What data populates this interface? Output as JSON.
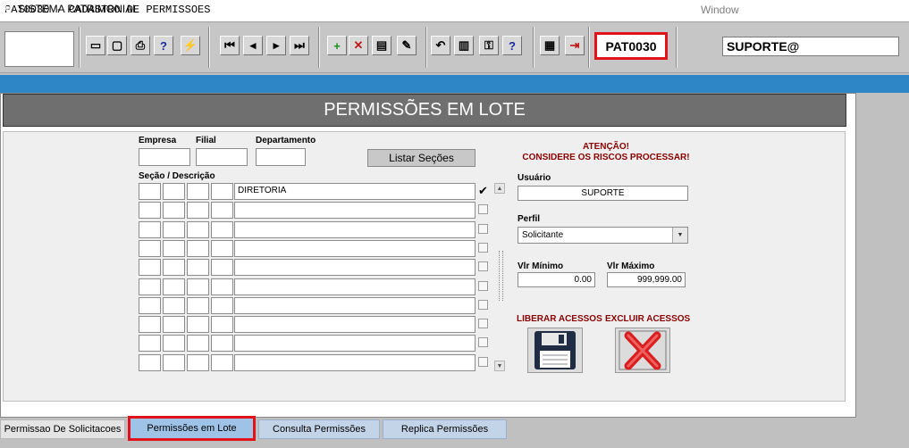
{
  "titlebar": {
    "title": "PAT0030 - CADASTRO DE PERMISSOES",
    "window_menu": "Window"
  },
  "toolbar": {
    "module_code": "PAT0030",
    "user": "SUPORTE@",
    "buttons": [
      {
        "name": "save-icon",
        "glyph": "▭"
      },
      {
        "name": "window-icon",
        "glyph": "▢"
      },
      {
        "name": "print-icon",
        "glyph": "⎙"
      },
      {
        "name": "help-query-icon",
        "glyph": "?"
      },
      {
        "name": "execute-query-icon",
        "glyph": "⚡"
      },
      {
        "name": "first-record-icon",
        "glyph": "⏮"
      },
      {
        "name": "previous-record-icon",
        "glyph": "◂"
      },
      {
        "name": "next-record-icon",
        "glyph": "▸"
      },
      {
        "name": "last-record-icon",
        "glyph": "⏭"
      },
      {
        "name": "insert-record-icon",
        "glyph": "+"
      },
      {
        "name": "delete-record-icon",
        "glyph": "✕"
      },
      {
        "name": "duplicate-record-icon",
        "glyph": "▤"
      },
      {
        "name": "clear-record-icon",
        "glyph": "✎"
      },
      {
        "name": "undo-icon",
        "glyph": "↶"
      },
      {
        "name": "clipboard-icon",
        "glyph": "▥"
      },
      {
        "name": "keys-icon",
        "glyph": "⚿"
      },
      {
        "name": "help-icon",
        "glyph": "?"
      },
      {
        "name": "menu-icon",
        "glyph": "▦"
      },
      {
        "name": "exit-icon",
        "glyph": "⇥"
      }
    ]
  },
  "system_bar": {
    "label": "SISTEMA PATRIMONIAL"
  },
  "header": {
    "title": "PERMISSÕES EM LOTE"
  },
  "form": {
    "empresa_label": "Empresa",
    "filial_label": "Filial",
    "departamento_label": "Departamento",
    "listar_button": "Listar Seções",
    "secao_label": "Seção / Descrição",
    "rows": [
      {
        "descricao": "DIRETORIA",
        "checked": true
      },
      {
        "descricao": "",
        "checked": false
      },
      {
        "descricao": "",
        "checked": false
      },
      {
        "descricao": "",
        "checked": false
      },
      {
        "descricao": "",
        "checked": false
      },
      {
        "descricao": "",
        "checked": false
      },
      {
        "descricao": "",
        "checked": false
      },
      {
        "descricao": "",
        "checked": false
      },
      {
        "descricao": "",
        "checked": false
      },
      {
        "descricao": "",
        "checked": false
      }
    ],
    "check_glyph": "✔"
  },
  "warning": {
    "line1": "ATENÇÃO!",
    "line2": "CONSIDERE OS RISCOS PROCESSAR!"
  },
  "usuario": {
    "label": "Usuário",
    "value": "SUPORTE"
  },
  "perfil": {
    "label": "Perfil",
    "value": "Solicitante"
  },
  "vlr_minimo": {
    "label": "Vlr Mínimo",
    "value": "0.00"
  },
  "vlr_maximo": {
    "label": "Vlr Máximo",
    "value": "999,999.00"
  },
  "actions": {
    "liberar_label": "LIBERAR ACESSOS",
    "excluir_label": "EXCLUIR ACESSOS"
  },
  "tabs": [
    {
      "label": "Permissao De Solicitacoes",
      "style": "plain"
    },
    {
      "label": "Permissões em Lote",
      "style": "active"
    },
    {
      "label": "Consulta Permissões",
      "style": "blue"
    },
    {
      "label": "Replica Permissões",
      "style": "blue"
    }
  ],
  "colors": {
    "highlight": "#e1121b",
    "system_bar": "#2f86c6",
    "warning": "#8b0000"
  }
}
